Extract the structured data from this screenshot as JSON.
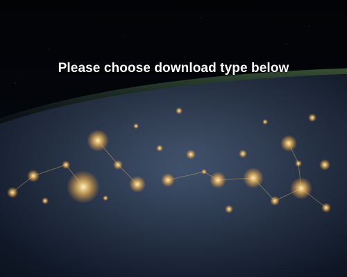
{
  "prompt": {
    "heading": "Please choose download type below"
  },
  "background": {
    "icon": "earth-night-icon"
  },
  "colors": {
    "heading_text": "#ffffff",
    "space": "#020305",
    "city_lights": "#ffd27a",
    "atmosphere": "#4f7a3a"
  }
}
